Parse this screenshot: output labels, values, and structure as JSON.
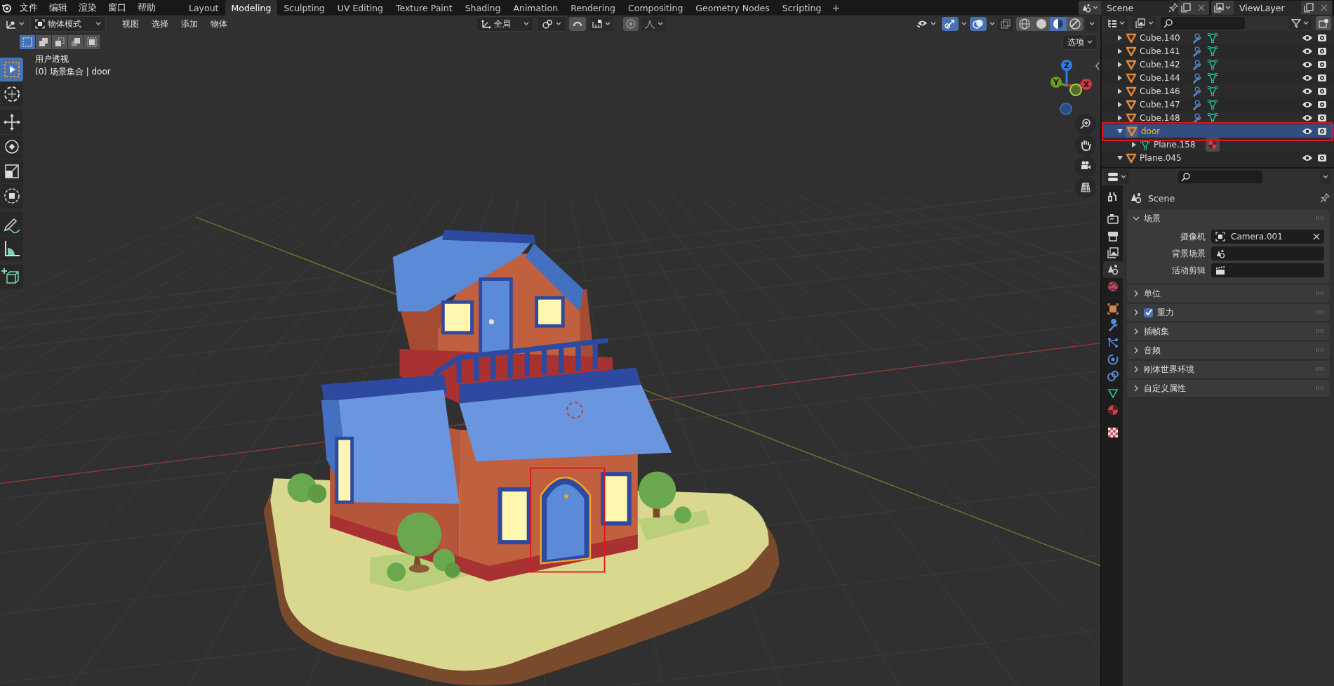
{
  "top_bar": {
    "menus": [
      "文件",
      "编辑",
      "渲染",
      "窗口",
      "帮助"
    ],
    "workspaces": [
      {
        "label": "Layout",
        "selected": false
      },
      {
        "label": "Modeling",
        "selected": true
      },
      {
        "label": "Sculpting",
        "selected": false
      },
      {
        "label": "UV Editing",
        "selected": false
      },
      {
        "label": "Texture Paint",
        "selected": false
      },
      {
        "label": "Shading",
        "selected": false
      },
      {
        "label": "Animation",
        "selected": false
      },
      {
        "label": "Rendering",
        "selected": false
      },
      {
        "label": "Compositing",
        "selected": false
      },
      {
        "label": "Geometry Nodes",
        "selected": false
      },
      {
        "label": "Scripting",
        "selected": false
      }
    ],
    "add_workspace": "+",
    "scene": "Scene",
    "view_layer": "ViewLayer"
  },
  "viewport": {
    "header": {
      "mode": "物体模式",
      "menus": [
        "视图",
        "选择",
        "添加",
        "物体"
      ],
      "orientation": "全局",
      "show_gizmos": true,
      "show_overlays": true,
      "xray": false,
      "shading_modes": [
        {
          "selected": false
        },
        {
          "selected": false
        },
        {
          "selected": true
        },
        {
          "selected": false
        }
      ]
    },
    "select_modes": [
      {
        "selected": true
      },
      {
        "selected": false
      },
      {
        "selected": false
      },
      {
        "selected": false
      },
      {
        "selected": false
      }
    ],
    "options": "选项",
    "view_name": "用户透视",
    "info": "(0) 场景集合 | door",
    "tools": [
      {
        "selected": true
      },
      {
        "selected": false
      },
      {
        "selected": false
      },
      {
        "selected": false
      },
      {
        "selected": false
      },
      {
        "selected": false
      },
      {
        "selected": false
      },
      {
        "selected": false
      },
      {
        "selected": false
      }
    ],
    "gizmo_axes": [
      {
        "label": "Z",
        "color": "#2f7fe0"
      },
      {
        "label": "Y",
        "color": "#6f9a1f"
      },
      {
        "label": "X",
        "color": "#d0344a"
      }
    ]
  },
  "outliner": {
    "items": [
      {
        "name": "Cube.140",
        "kind": "object",
        "expanded": false,
        "selected": false
      },
      {
        "name": "Cube.141",
        "kind": "object",
        "expanded": false,
        "selected": false
      },
      {
        "name": "Cube.142",
        "kind": "object",
        "expanded": false,
        "selected": false
      },
      {
        "name": "Cube.144",
        "kind": "object",
        "expanded": false,
        "selected": false
      },
      {
        "name": "Cube.146",
        "kind": "object",
        "expanded": false,
        "selected": false
      },
      {
        "name": "Cube.147",
        "kind": "object",
        "expanded": false,
        "selected": false
      },
      {
        "name": "Cube.148",
        "kind": "object",
        "expanded": false,
        "selected": false
      },
      {
        "name": "door",
        "kind": "object",
        "expanded": true,
        "selected": true,
        "children": [
          {
            "name": "Plane.158",
            "kind": "mesh",
            "expanded": false,
            "selected": false
          }
        ]
      },
      {
        "name": "Plane.045",
        "kind": "object",
        "expanded": true,
        "selected": false
      }
    ]
  },
  "properties": {
    "tabs": [
      {
        "selected": false
      },
      {
        "selected": false
      },
      {
        "selected": false
      },
      {
        "selected": false
      },
      {
        "selected": true
      },
      {
        "selected": false
      },
      {
        "selected": false
      },
      {
        "selected": false
      },
      {
        "selected": false
      },
      {
        "selected": false
      },
      {
        "selected": false
      },
      {
        "selected": false
      },
      {
        "selected": false
      },
      {
        "selected": false
      }
    ],
    "context": "Scene",
    "panels": [
      {
        "title": "场景",
        "kind": "plain",
        "expanded": true,
        "fields": [
          {
            "label": "摄像机",
            "kind": "camera",
            "value": "Camera.001"
          },
          {
            "label": "背景场景",
            "kind": "scene"
          },
          {
            "label": "活动剪辑",
            "kind": "clip"
          }
        ]
      },
      {
        "title": "单位",
        "kind": "plain",
        "expanded": false
      },
      {
        "title": "重力",
        "kind": "checkbox",
        "checked": true,
        "expanded": false
      },
      {
        "title": "插帧集",
        "kind": "plain",
        "expanded": false
      },
      {
        "title": "音频",
        "kind": "plain",
        "expanded": false
      },
      {
        "title": "刚体世界环境",
        "kind": "plain",
        "expanded": false
      },
      {
        "title": "自定义属性",
        "kind": "plain",
        "expanded": false
      }
    ]
  }
}
